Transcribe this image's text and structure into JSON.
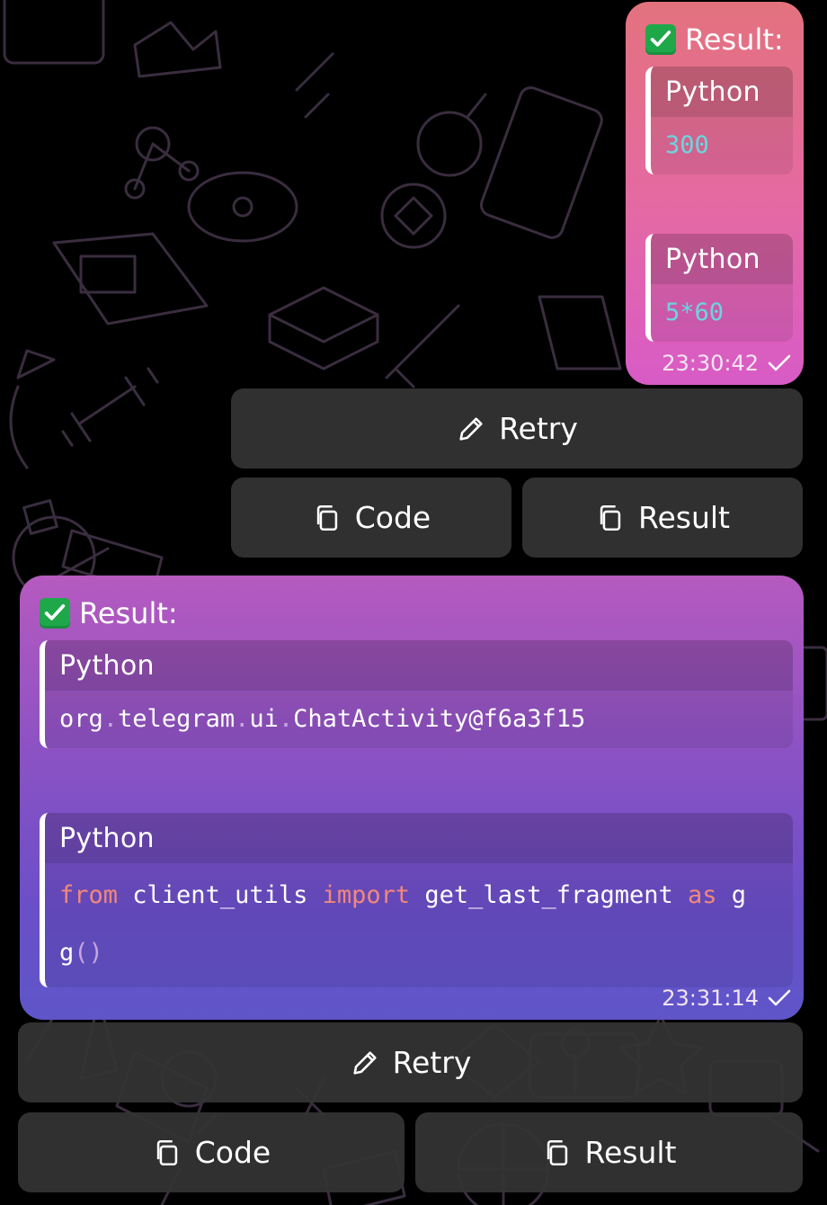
{
  "messages": [
    {
      "result_label": "Result:",
      "blocks": [
        {
          "lang": "Python",
          "code": "300"
        },
        {
          "lang": "Python",
          "code": "5*60"
        }
      ],
      "time": "23:30:42",
      "buttons": {
        "retry": "Retry",
        "code": "Code",
        "result": "Result"
      }
    },
    {
      "result_label": "Result:",
      "blocks": [
        {
          "lang": "Python",
          "code_parts": [
            "org",
            ".",
            "telegram",
            ".",
            "ui",
            ".",
            "ChatActivity@f6a3f15"
          ]
        },
        {
          "lang": "Python",
          "line1": [
            "from",
            " client_utils ",
            "import",
            " get_last_fragment ",
            "as",
            " g"
          ],
          "line2": [
            "g",
            "()"
          ]
        }
      ],
      "time": "23:31:14",
      "buttons": {
        "retry": "Retry",
        "code": "Code",
        "result": "Result"
      }
    }
  ],
  "icons": {
    "check_box": "check-box-icon",
    "read_check": "read-check-icon",
    "pencil": "pencil-icon",
    "copy": "copy-icon"
  },
  "colors": {
    "background": "#000000",
    "bubble1_top": "#e3727e",
    "bubble1_bottom": "#d85bc6",
    "bubble2_top": "#b65abf",
    "bubble2_bottom": "#5f55c9",
    "keyboard_button": "#343434",
    "keyword": "#f2877c",
    "number": "#6ad6e0"
  }
}
